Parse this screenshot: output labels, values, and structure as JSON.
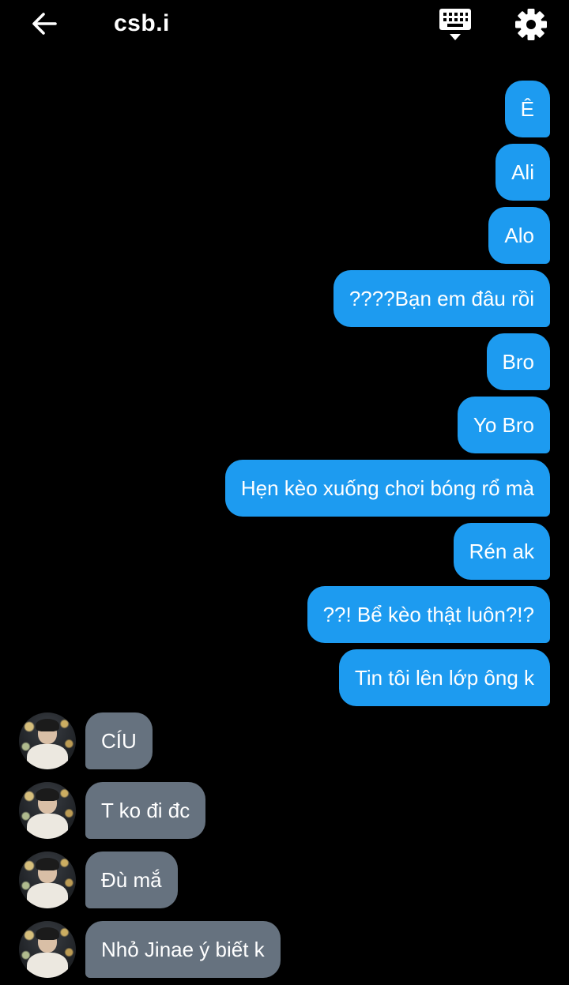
{
  "header": {
    "title": "csb.i",
    "back_icon": "arrow-left-icon",
    "keyboard_icon": "keyboard-icon",
    "settings_icon": "gear-icon"
  },
  "colors": {
    "background": "#000000",
    "sent_bubble": "#1d9bf0",
    "received_bubble": "#66727f",
    "text": "#ffffff"
  },
  "messages": [
    {
      "direction": "sent",
      "text": "Ê"
    },
    {
      "direction": "sent",
      "text": "Ali"
    },
    {
      "direction": "sent",
      "text": "Alo"
    },
    {
      "direction": "sent",
      "text": "????Bạn em đâu rồi"
    },
    {
      "direction": "sent",
      "text": "Bro"
    },
    {
      "direction": "sent",
      "text": "Yo Bro"
    },
    {
      "direction": "sent",
      "text": "Hẹn kèo xuống chơi bóng rổ mà"
    },
    {
      "direction": "sent",
      "text": "Rén ak"
    },
    {
      "direction": "sent",
      "text": "??! Bể kèo thật luôn?!?"
    },
    {
      "direction": "sent",
      "text": "Tin tôi lên lớp ông k"
    },
    {
      "direction": "received",
      "text": "CÍU"
    },
    {
      "direction": "received",
      "text": "T ko đi đc"
    },
    {
      "direction": "received",
      "text": "Đù mắ"
    },
    {
      "direction": "received",
      "text": "Nhỏ Jinae ý biết k"
    }
  ]
}
